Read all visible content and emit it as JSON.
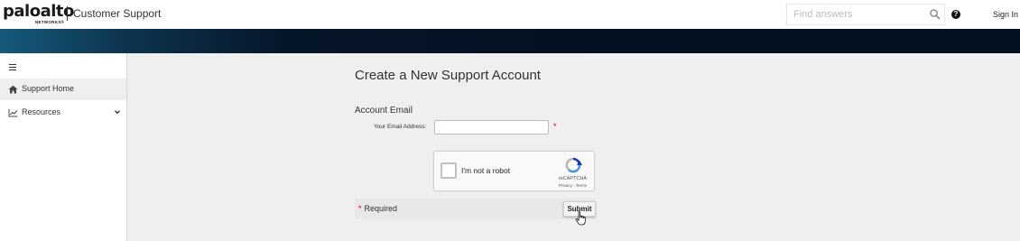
{
  "header": {
    "logo_text": "paloalto",
    "logo_subtext": "NETWORKS®",
    "site_title": "Customer Support",
    "search": {
      "placeholder": "Find answers",
      "value": "",
      "icon": "search-icon"
    },
    "help_icon": "question-circle-icon",
    "help_glyph": "?",
    "sign_in_label": "Sign In"
  },
  "sidebar": {
    "toggle_icon": "hamburger-menu-icon",
    "items": [
      {
        "label": "Support Home",
        "icon": "home-icon",
        "active": true
      },
      {
        "label": "Resources",
        "icon": "chart-line-icon",
        "expand_icon": "chevron-down-icon"
      }
    ]
  },
  "main": {
    "title": "Create a New Support Account",
    "section_title": "Account Email",
    "email_field": {
      "label": "Your Email Address:",
      "value": "",
      "required_mark": "*"
    },
    "captcha": {
      "checkbox_label": "I'm not a robot",
      "brand": "reCAPTCHA",
      "links": "Privacy - Terms"
    },
    "required_note": {
      "mark": "*",
      "text": "Required"
    },
    "submit_label": "Submit"
  },
  "colors": {
    "banner_dark": "#02101f",
    "banner_accent": "#165a7c",
    "required_red": "#cc0000",
    "recaptcha_blue": "#1c3aa9",
    "recaptcha_light_blue": "#4a90e2"
  }
}
